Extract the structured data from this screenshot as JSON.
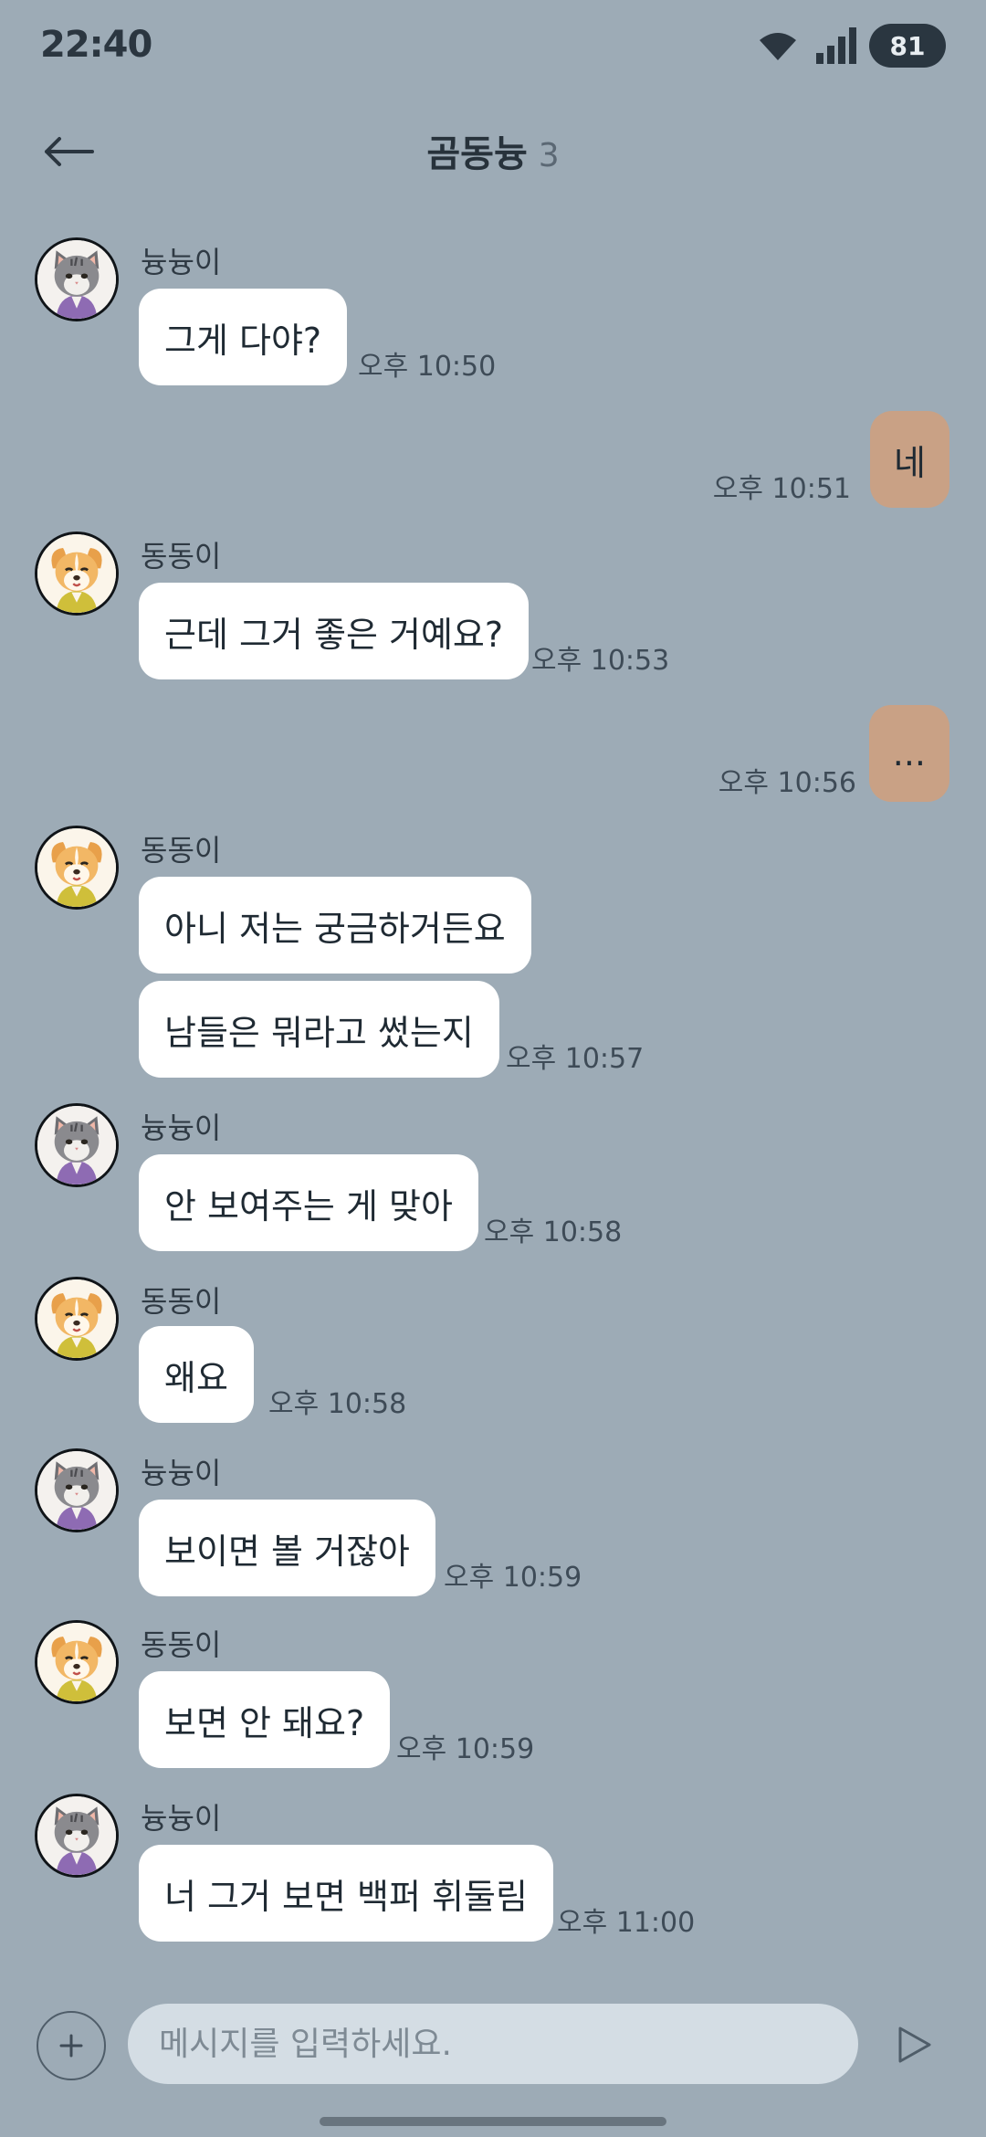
{
  "status_bar": {
    "time": "22:40",
    "battery": "81"
  },
  "header": {
    "title": "곰동늉",
    "member_count": "3"
  },
  "messages": [
    {
      "sender": "늉늉이",
      "text": "그게 다야?",
      "time": "오후 10:50"
    },
    {
      "text": "네",
      "time": "오후 10:51"
    },
    {
      "sender": "동동이",
      "text": "근데 그거 좋은 거예요?",
      "time": "오후 10:53"
    },
    {
      "text": "...",
      "time": "오후 10:56"
    },
    {
      "sender": "동동이",
      "text": "아니 저는 궁금하거든요",
      "text2": "남들은 뭐라고 썼는지",
      "time": "오후 10:57"
    },
    {
      "sender": "늉늉이",
      "text": "안 보여주는 게 맞아",
      "time": "오후 10:58"
    },
    {
      "sender": "동동이",
      "text": "왜요",
      "time": "오후 10:58"
    },
    {
      "sender": "늉늉이",
      "text": "보이면 볼 거잖아",
      "time": "오후 10:59"
    },
    {
      "sender": "동동이",
      "text": "보면 안 돼요?",
      "time": "오후 10:59"
    },
    {
      "sender": "늉늉이",
      "text": "너 그거 보면 백퍼 휘둘림",
      "time": "오후 11:00"
    }
  ],
  "composer": {
    "placeholder": "메시지를 입력하세요."
  },
  "icons": {
    "back": "arrow-left-icon",
    "wifi": "wifi-icon",
    "signal": "signal-icon",
    "plus": "plus-icon",
    "send": "send-icon",
    "cat_avatar": "cat-avatar",
    "dog_avatar": "dog-avatar"
  },
  "colors": {
    "background": "#9dabb6",
    "my_bubble": "#c9a185",
    "other_bubble": "#ffffff"
  }
}
